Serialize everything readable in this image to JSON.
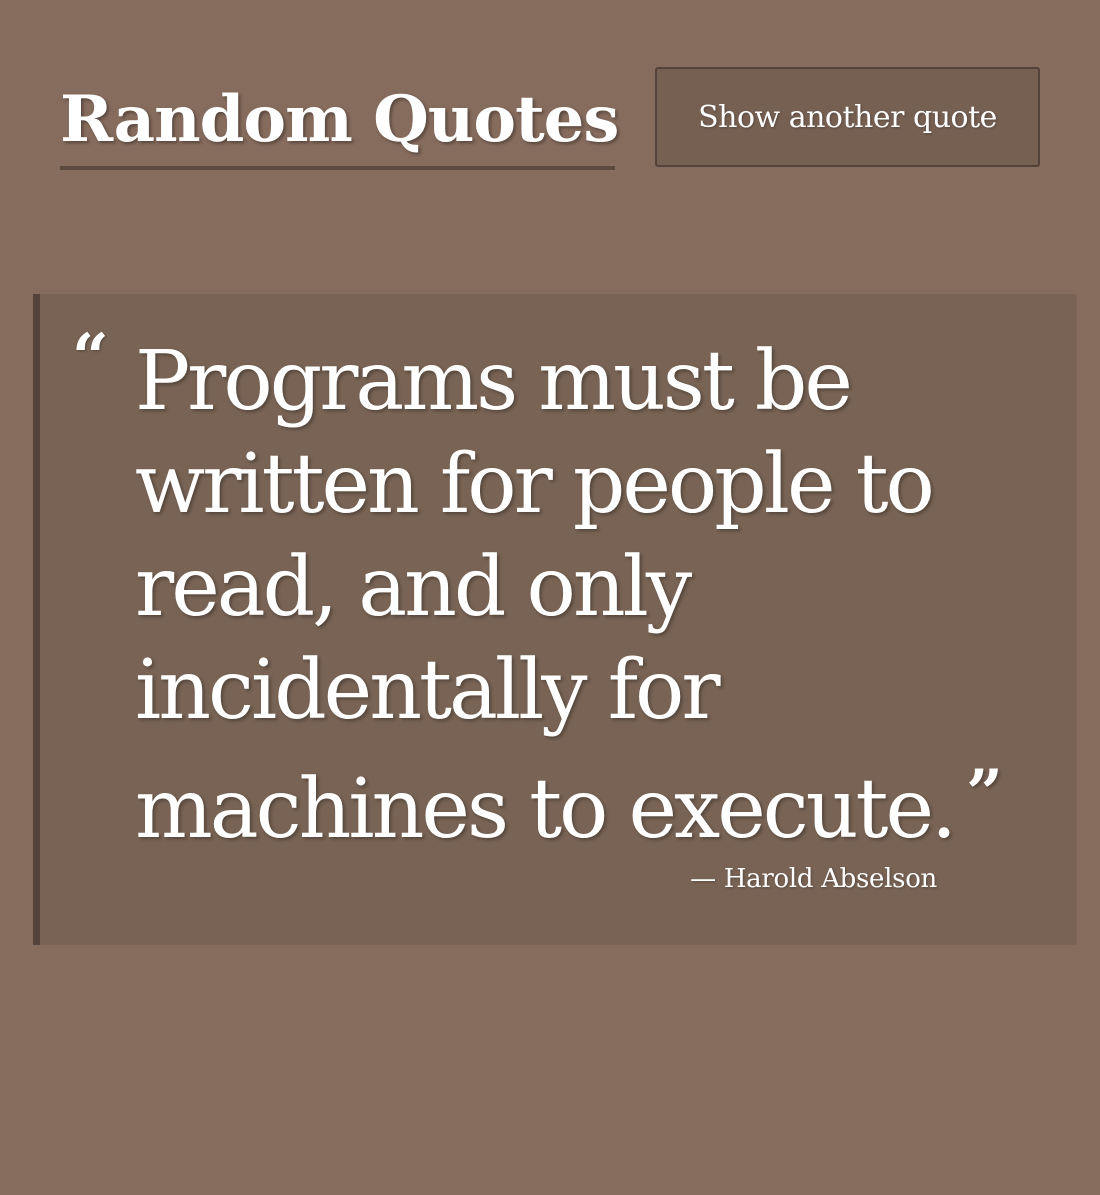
{
  "header": {
    "title": "Random Quotes",
    "button_label": "Show another quote"
  },
  "quote": {
    "open_mark": "“",
    "text": "Programs must be written for people to read, and only incidentally for machines to execute.",
    "close_mark": "”",
    "dash": "—",
    "author": "Harold Abselson"
  },
  "colors": {
    "background": "#866c5d",
    "card": "#786354",
    "card_border": "#54433a",
    "button": "#766052",
    "text": "#ffffff"
  }
}
